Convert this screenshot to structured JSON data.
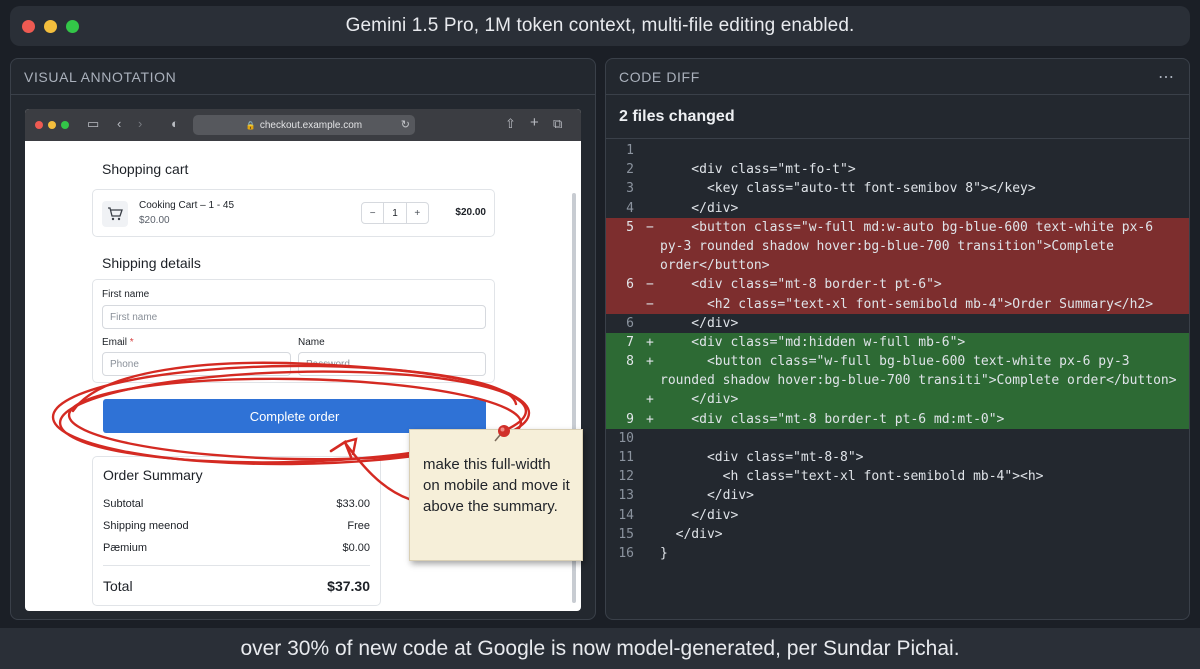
{
  "window": {
    "title": "Gemini 1.5 Pro, 1M token context, multi-file editing enabled."
  },
  "left_panel": {
    "header": "VISUAL ANNOTATION",
    "browser": {
      "url": "checkout.example.com"
    },
    "checkout": {
      "cart_heading": "Shopping cart",
      "item_name": "Cooking Cart – 1 - 45",
      "item_price": "$20.00",
      "qty_minus": "−",
      "qty_value": "1",
      "qty_plus": "+",
      "line_total": "$20.00",
      "shipping_heading": "Shipping details",
      "first_name_label": "First name",
      "first_name_placeholder": "First name",
      "email_label": "Email",
      "email_required": "*",
      "email_placeholder": "Phone",
      "name_label": "Name",
      "name_placeholder": "Password",
      "complete_button": "Complete order",
      "summary": {
        "title": "Order Summary",
        "rows": [
          {
            "label": "Subtotal",
            "value": "$33.00"
          },
          {
            "label": "Shipping meenod",
            "value": "Free"
          },
          {
            "label": "Pæmium",
            "value": "$0.00"
          }
        ],
        "total_label": "Total",
        "total_value": "$37.30"
      }
    },
    "sticky_note": "make this full-width on mobile and move it above the summary.",
    "annotation_color": "#d42a22"
  },
  "right_panel": {
    "header": "CODE DIFF",
    "more_icon": "⋯",
    "files_changed": "2 files changed",
    "lines": [
      {
        "n": "1",
        "m": "",
        "t": "",
        "type": "ctx"
      },
      {
        "n": "2",
        "m": "",
        "t": "    <div class=\"mt-fo-t\">",
        "type": "ctx"
      },
      {
        "n": "3",
        "m": "",
        "t": "      <key class=\"auto-tt font-semibov 8\"></key>",
        "type": "ctx"
      },
      {
        "n": "4",
        "m": "",
        "t": "    </div>",
        "type": "ctx"
      },
      {
        "n": "5",
        "m": "−",
        "t": "    <button class=\"w-full md:w-auto bg-blue-600 text-white px-6",
        "type": "del"
      },
      {
        "n": "",
        "m": "",
        "t": "py-3 rounded shadow hover:bg-blue-700 transition\">Complete",
        "type": "del"
      },
      {
        "n": "",
        "m": "",
        "t": "order</button>",
        "type": "del"
      },
      {
        "n": "6",
        "m": "−",
        "t": "    <div class=\"mt-8 border-t pt-6\">",
        "type": "del"
      },
      {
        "n": "",
        "m": "−",
        "t": "      <h2 class=\"text-xl font-semibold mb-4\">Order Summary</h2>",
        "type": "del"
      },
      {
        "n": "6",
        "m": "",
        "t": "    </div>",
        "type": "ctx"
      },
      {
        "n": "7",
        "m": "+",
        "t": "    <div class=\"md:hidden w-full mb-6\">",
        "type": "add"
      },
      {
        "n": "8",
        "m": "+",
        "t": "      <button class=\"w-full bg-blue-600 text-white px-6 py-3",
        "type": "add"
      },
      {
        "n": "",
        "m": "",
        "t": "rounded shadow hover:bg-blue-700 transiti\">Complete order</button>",
        "type": "add"
      },
      {
        "n": "",
        "m": "+",
        "t": "    </div>",
        "type": "add"
      },
      {
        "n": "9",
        "m": "+",
        "t": "    <div class=\"mt-8 border-t pt-6 md:mt-0\">",
        "type": "add"
      },
      {
        "n": "10",
        "m": "",
        "t": "",
        "type": "ctx"
      },
      {
        "n": "11",
        "m": "",
        "t": "      <div class=\"mt-8-8\">",
        "type": "ctx"
      },
      {
        "n": "12",
        "m": "",
        "t": "        <h class=\"text-xl font-semibold mb-4\"><h>",
        "type": "ctx"
      },
      {
        "n": "13",
        "m": "",
        "t": "      </div>",
        "type": "ctx"
      },
      {
        "n": "14",
        "m": "",
        "t": "    </div>",
        "type": "ctx"
      },
      {
        "n": "15",
        "m": "",
        "t": "  </div>",
        "type": "ctx"
      },
      {
        "n": "16",
        "m": "",
        "t": "}",
        "type": "ctx"
      }
    ]
  },
  "caption": "over 30% of new code at Google is now model-generated, per Sundar Pichai."
}
